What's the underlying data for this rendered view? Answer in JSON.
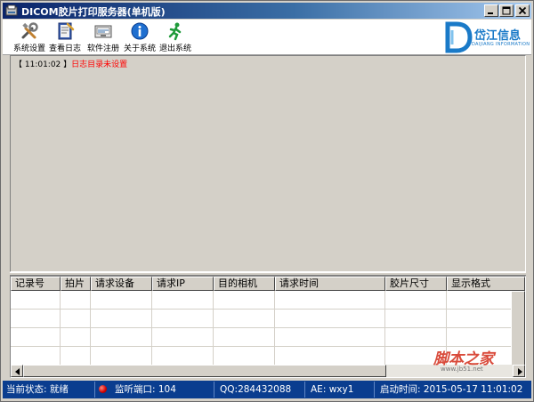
{
  "window": {
    "title": "DICOM胶片打印服务器(单机版)"
  },
  "toolbar": {
    "items": [
      {
        "label": "系统设置",
        "icon": "tools-icon"
      },
      {
        "label": "查看日志",
        "icon": "log-book-icon"
      },
      {
        "label": "软件注册",
        "icon": "register-icon"
      },
      {
        "label": "关于系统",
        "icon": "info-icon"
      },
      {
        "label": "退出系统",
        "icon": "exit-running-man-icon"
      }
    ]
  },
  "logo": {
    "name": "岱江信息",
    "sub": "DAIJIANG INFORMATION"
  },
  "log": {
    "time": "【 11:01:02 】",
    "message": "日志目录未设置"
  },
  "grid": {
    "columns": [
      "记录号",
      "拍片",
      "请求设备",
      "请求IP",
      "目的相机",
      "请求时间",
      "胶片尺寸",
      "显示格式"
    ],
    "rows": []
  },
  "watermark": {
    "main": "脚本之家",
    "url": "www.jb51.net"
  },
  "status": {
    "state": "当前状态: 就绪",
    "port": "监听端口: 104",
    "qq": "QQ:284432088",
    "ae": "AE: wxy1",
    "started": "启动时间: 2015-05-17 11:01:02"
  },
  "colors": {
    "titlebar_start": "#0a246a",
    "statusbar": "#0a3d8f",
    "log_message": "#ff0000",
    "brand": "#1a7ac8"
  }
}
